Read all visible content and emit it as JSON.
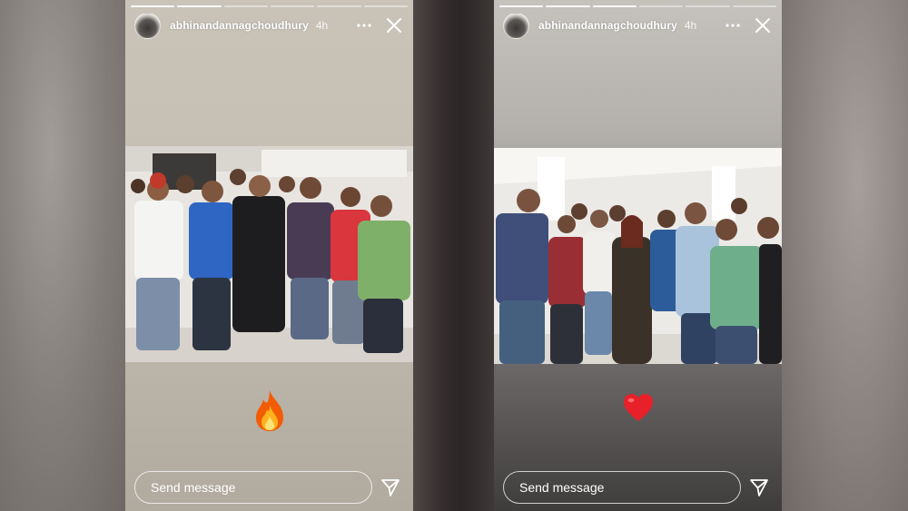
{
  "stories": [
    {
      "username": "abhinandannagchoudhury",
      "time": "4h",
      "reply_placeholder": "Send message",
      "sticker": "fire-emoji"
    },
    {
      "username": "abhinandannagchoudhury",
      "time": "4h",
      "reply_placeholder": "Send message",
      "sticker": "red-heart-emoji"
    }
  ],
  "icons": {
    "more": "more-horizontal-icon",
    "close": "close-icon",
    "send": "paper-plane-icon"
  },
  "colors": {
    "text": "#ffffff",
    "fire": "#ff6a13",
    "heart": "#e8202a"
  }
}
